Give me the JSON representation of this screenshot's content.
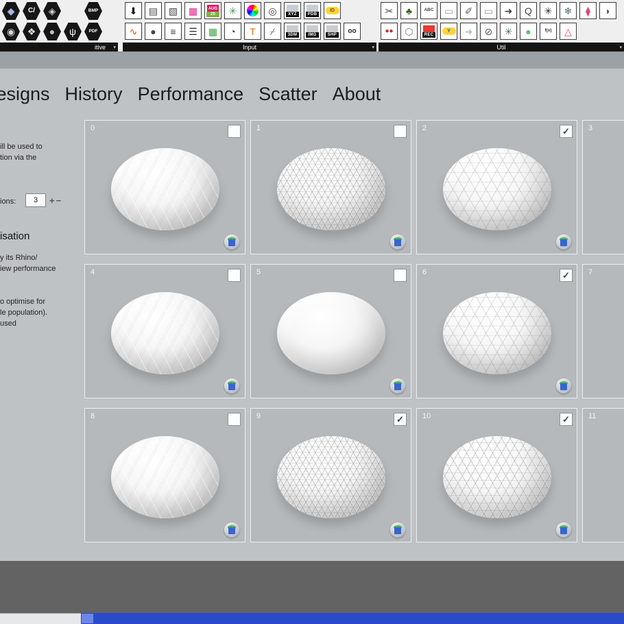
{
  "toolbar": {
    "groups": [
      {
        "label": "itive",
        "arrow": "▾",
        "kind": "hex",
        "rows": [
          [
            {
              "n": "box-primitive-icon",
              "g": "◆",
              "c": "#9fb6e8"
            },
            {
              "n": "script-c-icon",
              "g": "C/",
              "c": "#ffffff"
            },
            {
              "n": "gem-icon",
              "g": "◈",
              "c": "#cfcfcf"
            },
            null,
            {
              "n": "bmp-icon",
              "g": "BMP",
              "c": "#ffffff"
            }
          ],
          [
            {
              "n": "sphere-icon",
              "g": "◉",
              "c": "#d8d8d8"
            },
            {
              "n": "diamond-icon",
              "g": "❖",
              "c": "#cfe3ff"
            },
            {
              "n": "ball-icon",
              "g": "●",
              "c": "#bfbfbf"
            },
            {
              "n": "psi-icon",
              "g": "ψ",
              "c": "#ffffff"
            },
            {
              "n": "pdf-icon",
              "g": "PDF",
              "c": "#ffffff"
            }
          ]
        ]
      },
      {
        "label": "Input",
        "arrow": "▾",
        "kind": "sq",
        "rows": [
          [
            {
              "n": "import-file-icon",
              "g": "⬇",
              "c": "#111111"
            },
            {
              "n": "panel-icon",
              "g": "▤",
              "c": "#4a4a4a"
            },
            {
              "n": "panel-edit-icon",
              "g": "▧",
              "c": "#4a4a4a"
            },
            {
              "n": "gradient-slider-icon",
              "g": "▦",
              "c": "#e0218a"
            },
            {
              "n": "calendar-icon",
              "k": "tag",
              "top": "AUG",
              "topbg": "#d81b60",
              "lab": "20",
              "labbg": "#7cb342"
            },
            {
              "n": "mesh-icon",
              "g": "✳",
              "c": "#43a047"
            },
            {
              "n": "colour-wheel-icon",
              "k": "wheel"
            },
            {
              "n": "target-icon",
              "g": "◎",
              "c": "#333333"
            },
            {
              "n": "xyz-icon",
              "k": "tag",
              "top": "",
              "topbg": "#c9cdd1",
              "lab": "XYZ"
            },
            {
              "n": "pdb-icon",
              "k": "tag",
              "top": "",
              "topbg": "#c9cdd1",
              "lab": "PDB"
            },
            {
              "n": "id-icon",
              "k": "pill",
              "g": "ID",
              "c": "#6d5200",
              "b": "#ffd43a"
            }
          ],
          [
            {
              "n": "graph-mapper-icon",
              "g": "∿",
              "c": "#e65100"
            },
            {
              "n": "dark-sphere-icon",
              "g": "●",
              "c": "#3a4750"
            },
            {
              "n": "item-list-icon",
              "g": "≡",
              "c": "#333333"
            },
            {
              "n": "data-list-icon",
              "g": "☰",
              "c": "#333333"
            },
            {
              "n": "colour-swatch-icon",
              "g": "▦",
              "c": "#3ba53f"
            },
            {
              "n": "timer-icon",
              "g": "◔",
              "c": "#283593"
            },
            {
              "n": "text-tag-icon",
              "g": "T",
              "c": "#ef6c00"
            },
            {
              "n": "path-mapper-icon",
              "g": "⌿",
              "c": "#555555"
            },
            {
              "n": "3dm-icon",
              "k": "tag",
              "top": "",
              "topbg": "#c9cdd1",
              "lab": "3DM"
            },
            {
              "n": "img-icon",
              "k": "tag",
              "top": "",
              "topbg": "#c9cdd1",
              "lab": "IMG"
            },
            {
              "n": "shp-icon",
              "k": "tag",
              "top": "",
              "topbg": "#c9cdd1",
              "lab": "SHP"
            },
            {
              "n": "eyes-icon",
              "g": "oo",
              "c": "#222222"
            }
          ]
        ]
      },
      {
        "label": "Util",
        "arrow": "▾",
        "kind": "sq",
        "rows": [
          [
            {
              "n": "scatter-icon",
              "g": "✂",
              "c": "#37474f"
            },
            {
              "n": "tree-icon",
              "g": "♣",
              "c": "#33691e"
            },
            {
              "n": "abc-icon",
              "g": "ABC",
              "c": "#444444"
            },
            {
              "n": "capsule-icon",
              "g": "▭",
              "c": "#9e9e9e"
            },
            {
              "n": "pencil-icon",
              "g": "✐",
              "c": "#616161"
            },
            {
              "n": "pill-shape-icon",
              "g": "▭",
              "c": "#9e9e9e"
            },
            {
              "n": "arrow-solid-icon",
              "g": "➜",
              "c": "#37474f"
            },
            {
              "n": "zoom-query-icon",
              "g": "Q",
              "c": "#37474f"
            },
            {
              "n": "spark-dark-icon",
              "g": "✳",
              "c": "#263238"
            },
            {
              "n": "snowflake-icon",
              "g": "❄",
              "c": "#546e7a"
            },
            {
              "n": "droplet-icon",
              "g": "⧫",
              "c": "#ec407a"
            },
            {
              "n": "half-sphere-icon",
              "g": "◗",
              "c": "#455a64"
            }
          ],
          [
            {
              "n": "cherries-icon",
              "g": "●●",
              "c": "#c62828"
            },
            {
              "n": "hexagon-icon",
              "g": "⬡",
              "c": "#607d8b"
            },
            {
              "n": "rec-icon",
              "k": "tag",
              "top": "",
              "topbg": "#e53935",
              "lab": "REC"
            },
            {
              "n": "y-icon",
              "k": "pill",
              "g": "Y",
              "c": "#1565c0",
              "b": "#ffd43a"
            },
            {
              "n": "arrow-light-icon",
              "g": "➜",
              "c": "#b0bec5"
            },
            {
              "n": "circle-slash-icon",
              "g": "⊘",
              "c": "#455a64"
            },
            {
              "n": "spark-icon",
              "g": "✳",
              "c": "#546e7a"
            },
            {
              "n": "green-sphere-icon",
              "g": "●",
              "c": "#66bb6a"
            },
            {
              "n": "fx-icon",
              "g": "f(x)",
              "c": "#333333"
            },
            {
              "n": "pink-triangle-icon",
              "g": "△",
              "c": "#ec407a"
            }
          ]
        ]
      }
    ]
  },
  "tabs": [
    "Designs",
    "History",
    "Performance",
    "Scatter",
    "About"
  ],
  "panel": {
    "lines": [
      "ill be used to",
      "tion via the",
      "ions:",
      "isation",
      "y its Rhino/",
      "iew performance",
      "o optimise for",
      "le population).",
      "used"
    ],
    "stepper": {
      "value": "3",
      "plus": "+",
      "minus": "−"
    }
  },
  "grid": {
    "check_glyph": "✓",
    "tiles": [
      {
        "id": "0",
        "checked": false,
        "pattern": "faceted"
      },
      {
        "id": "1",
        "checked": false,
        "pattern": "spiky"
      },
      {
        "id": "2",
        "checked": true,
        "pattern": "geodesic"
      },
      {
        "id": "3",
        "checked": false,
        "pattern": "none",
        "clipped": true
      },
      {
        "id": "4",
        "checked": false,
        "pattern": "faceted"
      },
      {
        "id": "5",
        "checked": false,
        "pattern": "smooth"
      },
      {
        "id": "6",
        "checked": true,
        "pattern": "geodesic"
      },
      {
        "id": "7",
        "checked": false,
        "pattern": "none",
        "clipped": true
      },
      {
        "id": "8",
        "checked": false,
        "pattern": "faceted"
      },
      {
        "id": "9",
        "checked": true,
        "pattern": "spiky"
      },
      {
        "id": "10",
        "checked": true,
        "pattern": "spiky-geo"
      },
      {
        "id": "11",
        "checked": false,
        "pattern": "none",
        "clipped": true
      }
    ]
  }
}
